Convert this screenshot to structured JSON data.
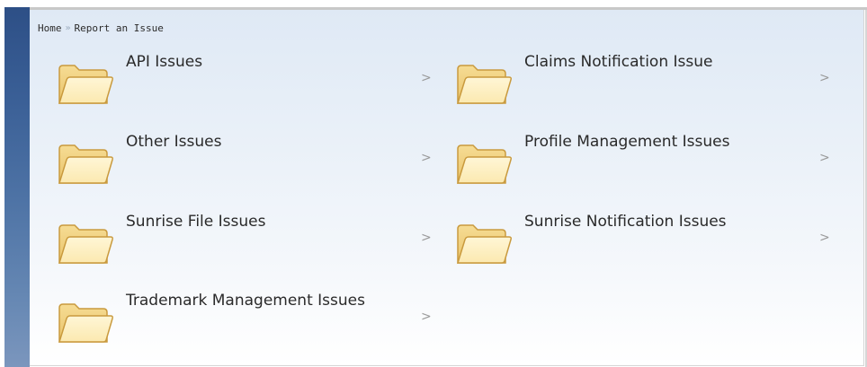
{
  "breadcrumb": {
    "home": "Home",
    "separator": "»",
    "current": "Report an Issue"
  },
  "colors": {
    "folder_fill": "#fbe9b0",
    "folder_stroke": "#c99a3e",
    "sidebar": "#3a5f96"
  },
  "categories": [
    {
      "label": "API Issues",
      "chevron": ">",
      "icon": "folder-icon"
    },
    {
      "label": "Claims Notification Issue",
      "chevron": ">",
      "icon": "folder-icon"
    },
    {
      "label": "Other Issues",
      "chevron": ">",
      "icon": "folder-icon"
    },
    {
      "label": "Profile Management Issues",
      "chevron": ">",
      "icon": "folder-icon"
    },
    {
      "label": "Sunrise File Issues",
      "chevron": ">",
      "icon": "folder-icon"
    },
    {
      "label": "Sunrise Notification Issues",
      "chevron": ">",
      "icon": "folder-icon"
    },
    {
      "label": "Trademark Management Issues",
      "chevron": ">",
      "icon": "folder-icon"
    }
  ]
}
